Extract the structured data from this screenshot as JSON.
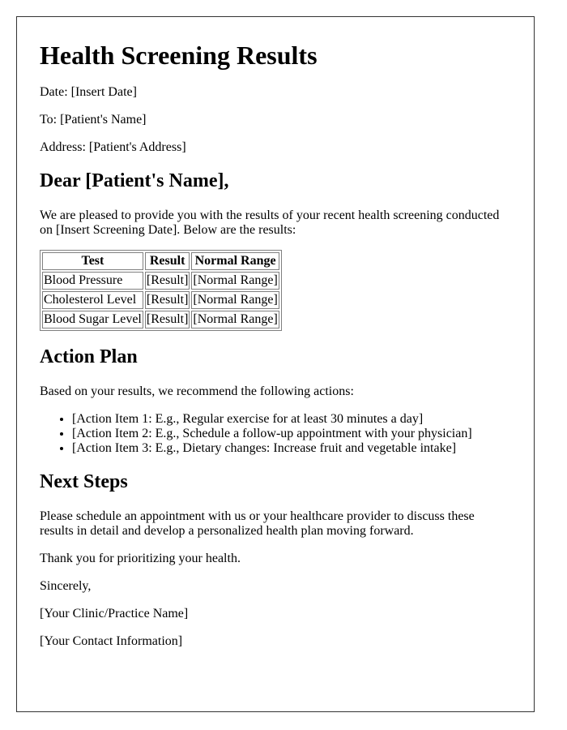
{
  "title": "Health Screening Results",
  "date_line": "Date: [Insert Date]",
  "to_line": "To: [Patient's Name]",
  "address_line": "Address: [Patient's Address]",
  "salutation": "Dear [Patient's Name],",
  "intro": "We are pleased to provide you with the results of your recent health screening conducted on [Insert Screening Date]. Below are the results:",
  "table": {
    "headers": [
      "Test",
      "Result",
      "Normal Range"
    ],
    "rows": [
      [
        "Blood Pressure",
        "[Result]",
        "[Normal Range]"
      ],
      [
        "Cholesterol Level",
        "[Result]",
        "[Normal Range]"
      ],
      [
        "Blood Sugar Level",
        "[Result]",
        "[Normal Range]"
      ]
    ]
  },
  "action_plan": {
    "heading": "Action Plan",
    "intro": "Based on your results, we recommend the following actions:",
    "items": [
      "[Action Item 1: E.g., Regular exercise for at least 30 minutes a day]",
      "[Action Item 2: E.g., Schedule a follow-up appointment with your physician]",
      "[Action Item 3: E.g., Dietary changes: Increase fruit and vegetable intake]"
    ]
  },
  "next_steps": {
    "heading": "Next Steps",
    "body": "Please schedule an appointment with us or your healthcare provider to discuss these results in detail and develop a personalized health plan moving forward."
  },
  "closing": {
    "thanks": "Thank you for prioritizing your health.",
    "sign_off": "Sincerely,",
    "clinic": "[Your Clinic/Practice Name]",
    "contact": "[Your Contact Information]"
  }
}
